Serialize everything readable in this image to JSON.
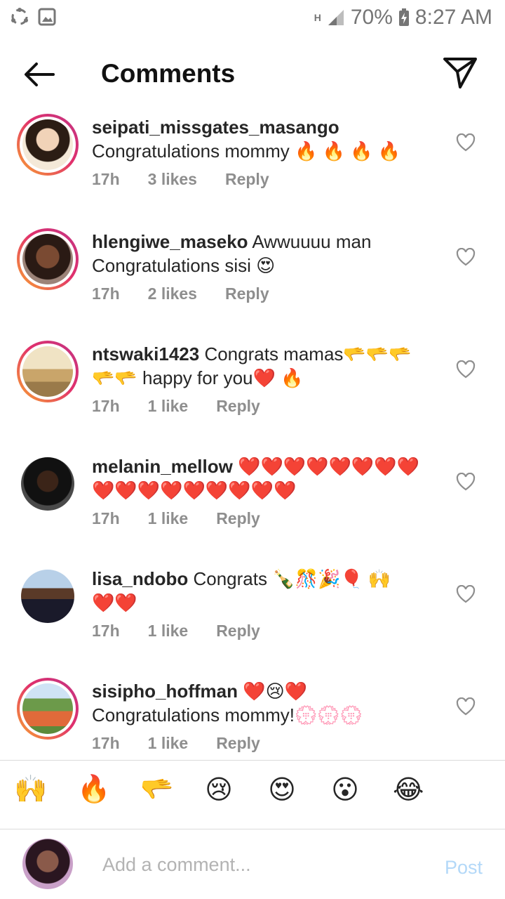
{
  "status_bar": {
    "battery": "70%",
    "time": "8:27 AM",
    "network": "H"
  },
  "header": {
    "title": "Comments"
  },
  "comments": [
    {
      "username": "seipati_missgates_masango",
      "text": "",
      "text_line2": "Congratulations mommy 🔥 🔥 🔥 🔥",
      "time": "17h",
      "likes": "3 likes",
      "reply": "Reply"
    },
    {
      "username": "hlengiwe_maseko",
      "text": " Awwuuuu man",
      "text_line2": "Congratulations sisi 😍",
      "time": "17h",
      "likes": "2 likes",
      "reply": "Reply"
    },
    {
      "username": "ntswaki1423",
      "text": " Congrats mamas🫳🫳🫳",
      "text_line2": "🫳🫳 happy for you❤️ 🔥",
      "time": "17h",
      "likes": "1 like",
      "reply": "Reply"
    },
    {
      "username": "melanin_mellow",
      "text": " ❤️❤️❤️❤️❤️❤️❤️❤️",
      "text_line2": "❤️❤️❤️❤️❤️❤️❤️❤️❤️",
      "time": "17h",
      "likes": "1 like",
      "reply": "Reply"
    },
    {
      "username": "lisa_ndobo",
      "text": " Congrats 🍾🎊🎉🎈 🙌",
      "text_line2": "❤️❤️",
      "time": "17h",
      "likes": "1 like",
      "reply": "Reply"
    },
    {
      "username": "sisipho_hoffman",
      "text": " ❤️😢❤️",
      "text_line2": "Congratulations mommy!💮💮💮",
      "time": "17h",
      "likes": "1 like",
      "reply": "Reply"
    }
  ],
  "quick_emojis": [
    "🙌",
    "🔥",
    "🫳",
    "😢",
    "😍",
    "😮",
    "😂"
  ],
  "composer": {
    "placeholder": "Add a comment...",
    "post_label": "Post"
  },
  "colors": {
    "story_ring_start": "#f9a530",
    "story_ring_end": "#c13584",
    "post_disabled": "#b3d8f8",
    "meta_gray": "#8e8e8e"
  }
}
